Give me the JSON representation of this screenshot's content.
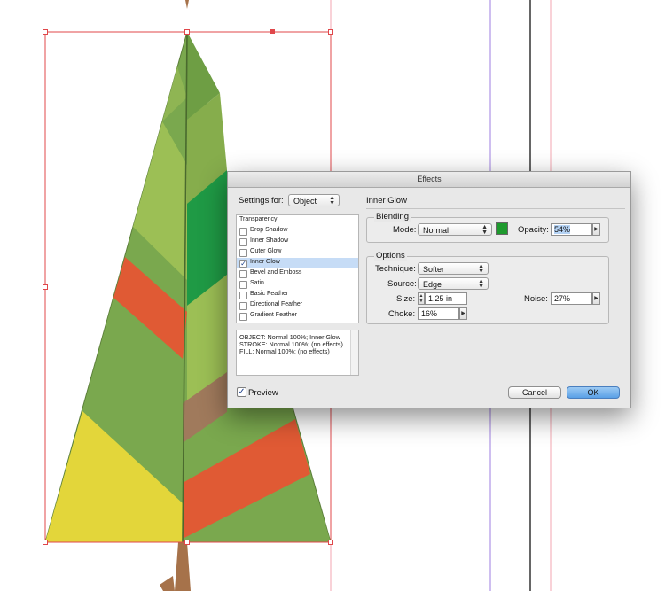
{
  "dialog": {
    "title": "Effects",
    "settings_for_label": "Settings for:",
    "settings_for_value": "Object",
    "effects_list": [
      {
        "label": "Transparency",
        "checked": false,
        "has_checkbox": false
      },
      {
        "label": "Drop Shadow",
        "checked": false,
        "has_checkbox": true
      },
      {
        "label": "Inner Shadow",
        "checked": false,
        "has_checkbox": true
      },
      {
        "label": "Outer Glow",
        "checked": false,
        "has_checkbox": true
      },
      {
        "label": "Inner Glow",
        "checked": true,
        "has_checkbox": true,
        "selected": true
      },
      {
        "label": "Bevel and Emboss",
        "checked": false,
        "has_checkbox": true
      },
      {
        "label": "Satin",
        "checked": false,
        "has_checkbox": true
      },
      {
        "label": "Basic Feather",
        "checked": false,
        "has_checkbox": true
      },
      {
        "label": "Directional Feather",
        "checked": false,
        "has_checkbox": true
      },
      {
        "label": "Gradient Feather",
        "checked": false,
        "has_checkbox": true
      }
    ],
    "summary_lines": [
      "OBJECT: Normal 100%; Inner Glow",
      "STROKE: Normal 100%; (no effects)",
      "FILL: Normal 100%; (no effects)"
    ],
    "preview_label": "Preview",
    "preview_checked": true,
    "section_title": "Inner Glow",
    "blending": {
      "title": "Blending",
      "mode_label": "Mode:",
      "mode_value": "Normal",
      "swatch_color": "#1e9a2e",
      "opacity_label": "Opacity:",
      "opacity_value": "54%"
    },
    "options": {
      "title": "Options",
      "technique_label": "Technique:",
      "technique_value": "Softer",
      "source_label": "Source:",
      "source_value": "Edge",
      "size_label": "Size:",
      "size_value": "1.25 in",
      "noise_label": "Noise:",
      "noise_value": "27%",
      "choke_label": "Choke:",
      "choke_value": "16%"
    },
    "cancel_label": "Cancel",
    "ok_label": "OK"
  },
  "colors": {
    "selection_frame": "#e0474a",
    "guide_purple": "#9d7ee0",
    "guide_black": "#000000",
    "guide_pink": "#f3a6b0",
    "leaf_green": "#7aa84e",
    "leaf_lightgreen": "#9cbf55",
    "leaf_darkgreen": "#1f9a45",
    "leaf_orange": "#e05a34",
    "leaf_yellow": "#e3d63a",
    "leaf_brown": "#a07a5c",
    "trunk": "#a6724a",
    "ok_blue": "#5aa0e6"
  }
}
